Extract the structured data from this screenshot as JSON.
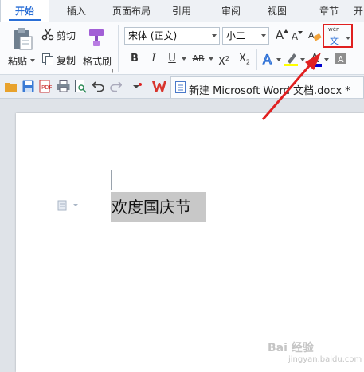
{
  "tabs": [
    {
      "label": "开始",
      "active": true
    },
    {
      "label": "插入"
    },
    {
      "label": "页面布局"
    },
    {
      "label": "引用"
    },
    {
      "label": "审阅"
    },
    {
      "label": "视图"
    },
    {
      "label": "章节"
    },
    {
      "label": "开"
    }
  ],
  "ribbon": {
    "paste_label": "粘贴",
    "cut_label": "剪切",
    "copy_label": "复制",
    "format_painter_label": "格式刷",
    "font_name": "宋体 (正文)",
    "font_size": "小二",
    "bold_label": "B",
    "italic_label": "I",
    "underline_label": "U",
    "strike_label": "AB",
    "superscript_label": "X",
    "superscript_mark": "2",
    "subscript_label": "X",
    "subscript_mark": "2",
    "grow_font_label": "A",
    "shrink_font_label": "A",
    "phonetic_top": "wén",
    "phonetic_bottom": "文"
  },
  "quick_access": {
    "doc_title": "新建 Microsoft Word 文档.docx *"
  },
  "document": {
    "selected_text": "欢度国庆节"
  },
  "watermark": {
    "line1": "Bai 经验",
    "line2": "jingyan.baidu.com"
  },
  "colors": {
    "accent": "#2b6fd6",
    "highlight": "#e02020",
    "selection": "#c8c8c8",
    "font_color_bar": "#0000cc",
    "highlighter_bar": "#ffff00"
  }
}
